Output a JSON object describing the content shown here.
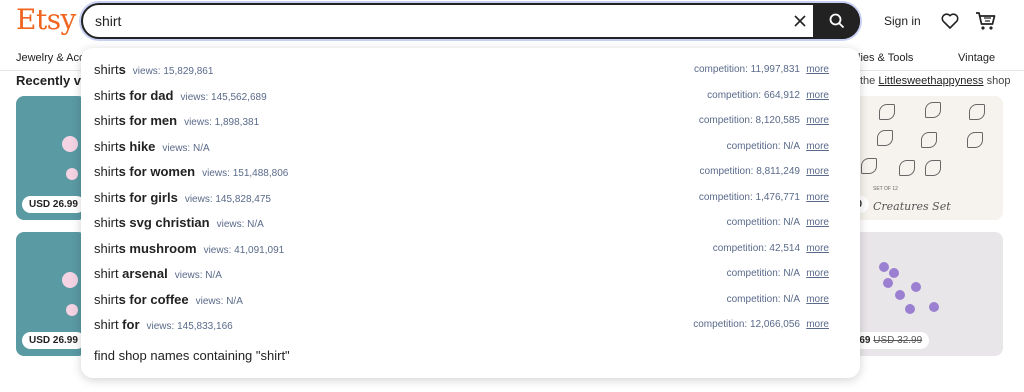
{
  "header": {
    "logo": "Etsy",
    "search_value": "shirt",
    "sign_in": "Sign in"
  },
  "icons": {
    "clear": "close-icon",
    "search": "search-icon",
    "favorites": "heart-icon",
    "cart": "cart-icon"
  },
  "colors": {
    "brand": "#f1641e",
    "search_border": "#222222",
    "stats_text": "#5a6a8a"
  },
  "nav": {
    "left_item": "Jewelry & Acc",
    "right_item_1": "lies & Tools",
    "right_item_2": "Vintage"
  },
  "page": {
    "recent_heading": "Recently vi",
    "shop_prefix": "the ",
    "shop_name": "Littlesweethappyness",
    "shop_suffix": " shop",
    "cards": {
      "left_1_price": "USD 26.99",
      "left_2_price": "USD 26.99",
      "right_1_price": "00",
      "right_1_title": "Creatures Set",
      "right_1_subtitle": "SET OF 12",
      "right_2_price": "9.69",
      "right_2_old_price": "USD 32.99"
    }
  },
  "suggestions": [
    {
      "prefix": "shirt",
      "suffix": "s",
      "views": "views: 15,829,861",
      "competition": "competition: 11,997,831",
      "more": "more"
    },
    {
      "prefix": "shirt",
      "suffix": "s for dad",
      "views": "views: 145,562,689",
      "competition": "competition: 664,912",
      "more": "more"
    },
    {
      "prefix": "shirt",
      "suffix": "s for men",
      "views": "views: 1,898,381",
      "competition": "competition: 8,120,585",
      "more": "more"
    },
    {
      "prefix": "shirt",
      "suffix": "s hike",
      "views": "views: N/A",
      "competition": "competition: N/A",
      "more": "more"
    },
    {
      "prefix": "shirt",
      "suffix": "s for women",
      "views": "views: 151,488,806",
      "competition": "competition: 8,811,249",
      "more": "more"
    },
    {
      "prefix": "shirt",
      "suffix": "s for girls",
      "views": "views: 145,828,475",
      "competition": "competition: 1,476,771",
      "more": "more"
    },
    {
      "prefix": "shirt",
      "suffix": "s svg christian",
      "views": "views: N/A",
      "competition": "competition: N/A",
      "more": "more"
    },
    {
      "prefix": "shirt",
      "suffix": "s mushroom",
      "views": "views: 41,091,091",
      "competition": "competition: 42,514",
      "more": "more"
    },
    {
      "prefix": "shirt",
      "suffix": " arsenal",
      "views": "views: N/A",
      "competition": "competition: N/A",
      "more": "more"
    },
    {
      "prefix": "shirt",
      "suffix": "s for coffee",
      "views": "views: N/A",
      "competition": "competition: N/A",
      "more": "more"
    },
    {
      "prefix": "shirt",
      "suffix": " for",
      "views": "views: 145,833,166",
      "competition": "competition: 12,066,056",
      "more": "more"
    }
  ],
  "find_shop": "find shop names containing \"shirt\""
}
